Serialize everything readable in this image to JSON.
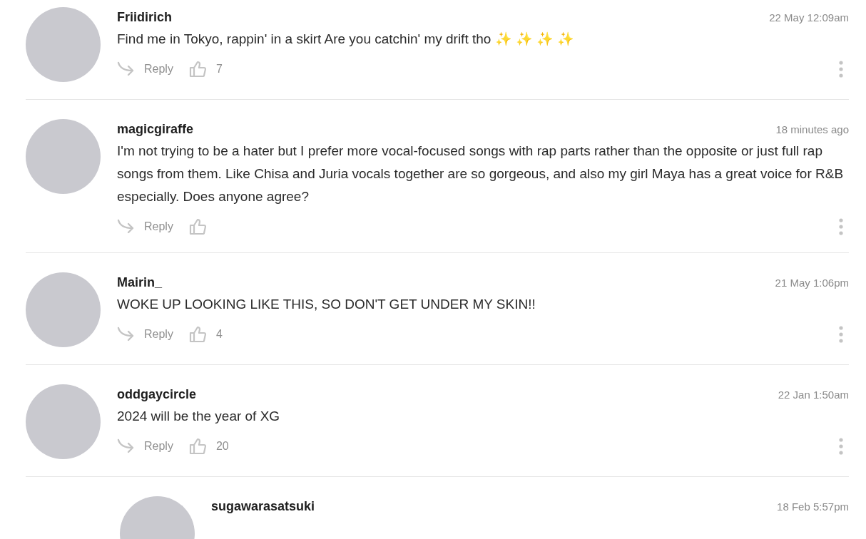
{
  "comments": [
    {
      "author": "Friidirich",
      "time": "22 May 12:09am",
      "text": "Find me in Tokyo, rappin' in a skirt Are you catchin' my drift tho ✨ ✨ ✨ ✨",
      "reply_label": "Reply",
      "likes": "7"
    },
    {
      "author": "magicgiraffe",
      "time": "18 minutes ago",
      "text": "I'm not trying to be a hater but I prefer more vocal-focused songs with rap parts rather than the opposite or just full rap songs from them. Like Chisa and Juria vocals together are so gorgeous, and also my girl Maya has a great voice for R&B especially. Does anyone agree?",
      "reply_label": "Reply"
    },
    {
      "author": "Mairin_",
      "time": "21 May 1:06pm",
      "text": "WOKE UP LOOKING LIKE THIS, SO DON'T GET UNDER MY SKIN!!",
      "reply_label": "Reply",
      "likes": "4"
    },
    {
      "author": "oddgaycircle",
      "time": "22 Jan 1:50am",
      "text": "2024 will be the year of XG",
      "reply_label": "Reply",
      "likes": "20",
      "children": [
        {
          "author": "sugawarasatsuki",
          "time": "18 Feb 5:57pm"
        }
      ]
    }
  ]
}
